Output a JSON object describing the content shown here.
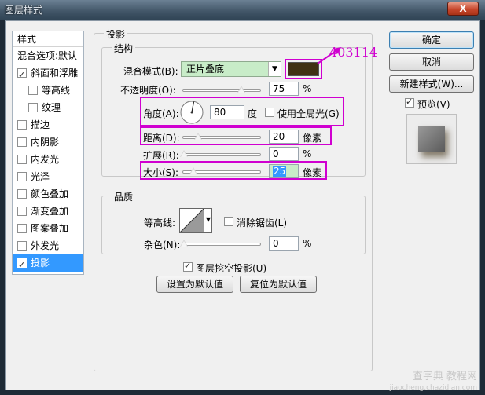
{
  "window": {
    "title": "图层样式",
    "close_label": "X"
  },
  "left_list": {
    "header": "样式",
    "blend_item": "混合选项:默认",
    "items": [
      {
        "label": "斜面和浮雕",
        "checked": true,
        "sub": false,
        "selected": false
      },
      {
        "label": "等高线",
        "checked": false,
        "sub": true,
        "selected": false
      },
      {
        "label": "纹理",
        "checked": false,
        "sub": true,
        "selected": false
      },
      {
        "label": "描边",
        "checked": false,
        "sub": false,
        "selected": false
      },
      {
        "label": "内阴影",
        "checked": false,
        "sub": false,
        "selected": false
      },
      {
        "label": "内发光",
        "checked": false,
        "sub": false,
        "selected": false
      },
      {
        "label": "光泽",
        "checked": false,
        "sub": false,
        "selected": false
      },
      {
        "label": "颜色叠加",
        "checked": false,
        "sub": false,
        "selected": false
      },
      {
        "label": "渐变叠加",
        "checked": false,
        "sub": false,
        "selected": false
      },
      {
        "label": "图案叠加",
        "checked": false,
        "sub": false,
        "selected": false
      },
      {
        "label": "外发光",
        "checked": false,
        "sub": false,
        "selected": false
      },
      {
        "label": "投影",
        "checked": true,
        "sub": false,
        "selected": true
      }
    ]
  },
  "drop_shadow": {
    "section_title": "投影",
    "structure_title": "结构",
    "blend_mode_label": "混合模式(B):",
    "blend_mode_value": "正片叠底",
    "shadow_color": "#403114",
    "color_annotation": "403114",
    "opacity_label": "不透明度(O):",
    "opacity_value": "75",
    "opacity_unit": "%",
    "opacity_level": 0.75,
    "angle_label": "角度(A):",
    "angle_value": "80",
    "angle_unit": "度",
    "global_light_label": "使用全局光(G)",
    "global_light_checked": false,
    "distance_label": "距离(D):",
    "distance_value": "20",
    "distance_unit": "像素",
    "spread_label": "扩展(R):",
    "spread_value": "0",
    "spread_unit": "%",
    "size_label": "大小(S):",
    "size_value": "25",
    "size_unit": "像素",
    "quality_title": "品质",
    "contour_label": "等高线:",
    "anti_alias_label": "消除锯齿(L)",
    "anti_alias_checked": false,
    "noise_label": "杂色(N):",
    "noise_value": "0",
    "noise_unit": "%",
    "knockout_label": "图层挖空投影(U)",
    "knockout_checked": true,
    "make_default_label": "设置为默认值",
    "reset_default_label": "复位为默认值"
  },
  "buttons": {
    "ok": "确定",
    "cancel": "取消",
    "new_style": "新建样式(W)...",
    "preview_label": "预览(V)",
    "preview_checked": true
  },
  "watermark": {
    "line1": "查字典 教程网",
    "line2": "jiaocheng.chazidian.com"
  },
  "colors": {
    "highlight": "#d000d0",
    "selected": "#3399ff",
    "green_field": "#c8ecc8"
  }
}
